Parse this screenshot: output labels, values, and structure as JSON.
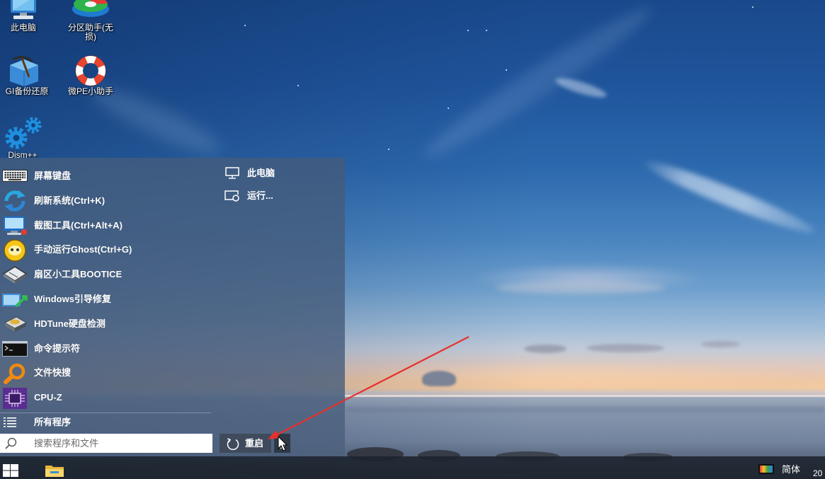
{
  "desktop": {
    "icons": [
      {
        "label": "此电脑",
        "icon": "computer-icon"
      },
      {
        "label": "分区助手(无损)",
        "icon": "partition-assistant-icon"
      },
      {
        "label": "GI备份还原",
        "icon": "ghost-backup-icon"
      },
      {
        "label": "微PE小助手",
        "icon": "lifebuoy-icon"
      },
      {
        "label": "Dism++",
        "icon": "gears-icon"
      }
    ]
  },
  "start_menu": {
    "programs": [
      {
        "label": "屏幕键盘",
        "icon": "keyboard-icon"
      },
      {
        "label": "刷新系统(Ctrl+K)",
        "icon": "refresh-icon"
      },
      {
        "label": "截图工具(Ctrl+Alt+A)",
        "icon": "screenshot-monitor-icon"
      },
      {
        "label": "手动运行Ghost(Ctrl+G)",
        "icon": "ghost-icon"
      },
      {
        "label": "扇区小工具BOOTICE",
        "icon": "bootice-disk-icon"
      },
      {
        "label": "Windows引导修复",
        "icon": "boot-repair-icon"
      },
      {
        "label": "HDTune硬盘检测",
        "icon": "hard-disk-icon"
      },
      {
        "label": "命令提示符",
        "icon": "command-prompt-icon"
      },
      {
        "label": "文件快搜",
        "icon": "magnifier-icon"
      },
      {
        "label": "CPU-Z",
        "icon": "cpu-chip-icon"
      }
    ],
    "all_programs": {
      "label": "所有程序",
      "icon": "list-icon"
    },
    "places": [
      {
        "label": "此电脑",
        "icon": "computer-outline-icon"
      },
      {
        "label": "运行...",
        "icon": "run-icon"
      }
    ],
    "search": {
      "placeholder": "搜索程序和文件",
      "value": ""
    },
    "power": {
      "label": "重启",
      "icon": "restart-icon"
    }
  },
  "taskbar": {
    "pinned": [
      {
        "icon": "windows-logo-icon"
      },
      {
        "icon": "folder-icon"
      }
    ],
    "tray": {
      "input_method": "简体",
      "clock": "20"
    }
  },
  "colors": {
    "annotation_arrow": "#e8302a",
    "menu_background": "#4a6282cc",
    "menu_text": "#ffffff",
    "taskbar_background": "#1c232ee0"
  }
}
